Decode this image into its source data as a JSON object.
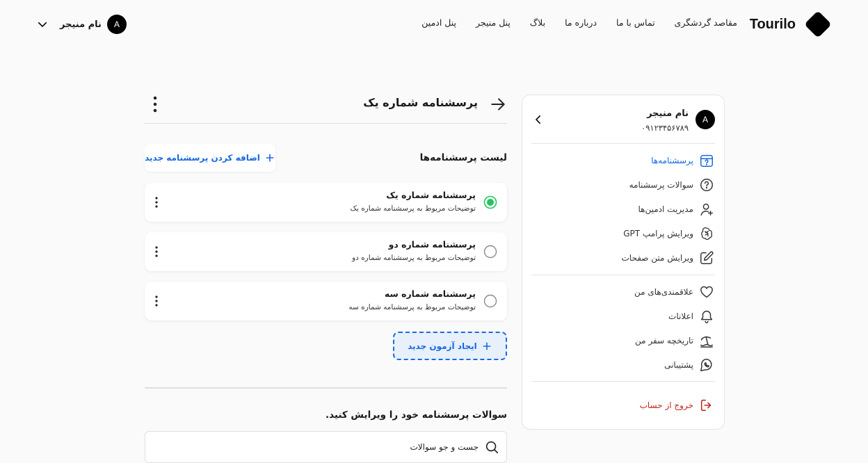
{
  "brand": {
    "name": "Tourilo"
  },
  "nav": {
    "items": [
      {
        "label": "مقاصد گردشگری"
      },
      {
        "label": "تماس با ما"
      },
      {
        "label": "درباره ما"
      },
      {
        "label": "بلاگ"
      },
      {
        "label": "پنل منیجر"
      },
      {
        "label": "پنل ادمین"
      }
    ]
  },
  "user": {
    "avatar_letter": "A",
    "name": "نام منیجر",
    "phone": "۰۹۱۲۳۴۵۶۷۸۹"
  },
  "sidebar": {
    "groups": [
      {
        "items": [
          {
            "label": "پرسشنامه‌ها",
            "icon": "questionnaire-icon",
            "active": true
          },
          {
            "label": "سوالات پرسشنامه",
            "icon": "question-circle-icon"
          },
          {
            "label": "مدیریت ادمین‌ها",
            "icon": "user-add-icon"
          },
          {
            "label": "ویرایش پرامپ GPT",
            "icon": "gpt-icon"
          },
          {
            "label": "ویرایش متن صفحات",
            "icon": "edit-icon"
          }
        ]
      },
      {
        "items": [
          {
            "label": "علاقمندی‌های من",
            "icon": "heart-icon"
          },
          {
            "label": "اعلانات",
            "icon": "bell-icon"
          },
          {
            "label": "تاریخچه سفر من",
            "icon": "beach-icon"
          },
          {
            "label": "پشتیبانی",
            "icon": "support-icon"
          }
        ]
      }
    ],
    "logout": {
      "label": "خروج از حساب",
      "icon": "logout-icon"
    }
  },
  "main": {
    "title": "پرسشنامه شماره یک",
    "list_title": "لیست پرسشنامه‌ها",
    "add_button": "اضافه کردن پرسشنامه جدید",
    "questionnaires": [
      {
        "name": "پرسشنامه شماره یک",
        "description": "توضیحات مربوط به پرسشنامه شماره یک",
        "selected": true
      },
      {
        "name": "پرسشنامه شماره دو",
        "description": "توضیحات مربوط به پرسشنامه شماره دو",
        "selected": false
      },
      {
        "name": "پرسشنامه شماره سه",
        "description": "توضیحات مربوط به پرسشنامه شماره سه",
        "selected": false
      }
    ],
    "new_exam_button": "ایجاد آزمون جدید",
    "edit_title": "سوالات پرسشنامه خود را ویرایش کنید.",
    "search": {
      "value": "",
      "placeholder": "جست و جو سوالات"
    }
  },
  "colors": {
    "accent": "#1769e0",
    "selected": "#22c55e",
    "danger": "#c0281e"
  }
}
